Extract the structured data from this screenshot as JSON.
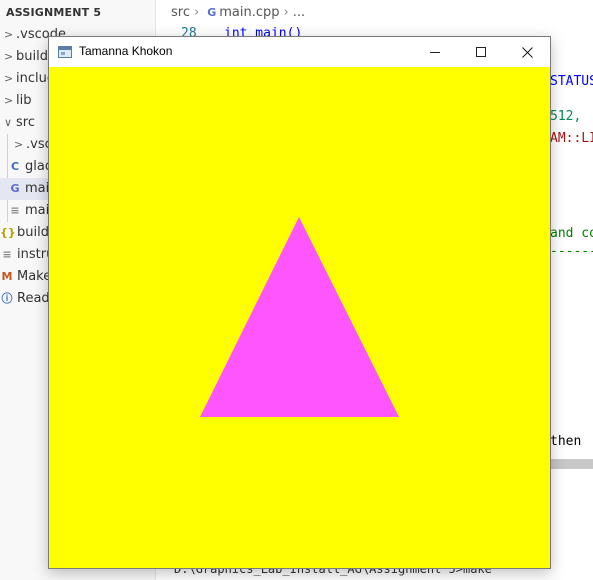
{
  "sidebar": {
    "title": "ASSIGNMENT 5",
    "items": [
      {
        "label": ".vscode",
        "twisty": ">",
        "icon": "",
        "icon_name": "none"
      },
      {
        "label": "build",
        "twisty": ">",
        "icon": "",
        "icon_name": "none"
      },
      {
        "label": "include",
        "twisty": ">",
        "icon": "",
        "icon_name": "none"
      },
      {
        "label": "lib",
        "twisty": ">",
        "icon": "",
        "icon_name": "none"
      },
      {
        "label": "src",
        "twisty": "∨",
        "icon": "",
        "icon_name": "none"
      },
      {
        "label": ".vscode",
        "twisty": ">",
        "icon": "",
        "icon_name": "none"
      },
      {
        "label": "glad.c",
        "twisty": "",
        "icon": "C",
        "icon_name": "c-file-icon"
      },
      {
        "label": "main.cpp",
        "twisty": "",
        "icon": "G",
        "icon_name": "cpp-file-icon"
      },
      {
        "label": "main",
        "twisty": "",
        "icon": "≡",
        "icon_name": "text-file-icon"
      },
      {
        "label": "build",
        "twisty": "",
        "icon": "{}",
        "icon_name": "json-file-icon"
      },
      {
        "label": "instructions",
        "twisty": "",
        "icon": "≡",
        "icon_name": "text-file-icon"
      },
      {
        "label": "Makefile",
        "twisty": "",
        "icon": "M",
        "icon_name": "makefile-icon"
      },
      {
        "label": "Readme",
        "twisty": "",
        "icon": "ⓘ",
        "icon_name": "info-icon"
      }
    ]
  },
  "editor": {
    "breadcrumb": {
      "folder": "src",
      "file": "main.cpp",
      "more": "..."
    },
    "line_number": "28",
    "code_line": "int main()",
    "fragments": {
      "status": "STATUS",
      "num512": "512,",
      "ami": "AM::LI",
      "andco": "and co",
      "dashes": "-------",
      "then": "then"
    },
    "terminal": "D:\\Graphics_Lab_Install_AG\\Assignment 5>make"
  },
  "window": {
    "title": "Tamanna Khokon",
    "background_color": "#ffff00",
    "triangle_color": "#ff55ff"
  },
  "colors": {
    "vscode_cpp": "#5b6ccf",
    "vscode_c": "#3a6ec1",
    "vscode_json": "#b8a000",
    "vscode_makefile": "#c2571a",
    "vscode_info": "#3a6ec1"
  }
}
